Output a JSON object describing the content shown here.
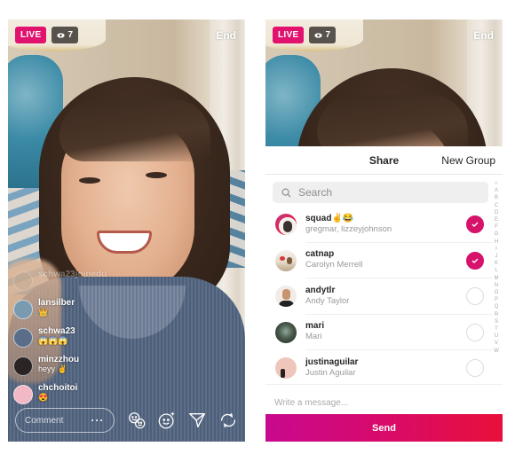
{
  "left_phone": {
    "live_badge": "LIVE",
    "viewer_count": "7",
    "end_label": "End",
    "comments": [
      {
        "user": "schwa23joinedu",
        "message": "",
        "avatar_color": "#b9a68f",
        "faded": true
      },
      {
        "user": "lansilber",
        "message": "👑",
        "avatar_color": "#7a9ab0"
      },
      {
        "user": "schwa23",
        "message": "😱😱😱",
        "avatar_color": "#5a6e8a"
      },
      {
        "user": "minzzhou",
        "message": "heyy ✌",
        "avatar_color": "#2b2424"
      },
      {
        "user": "chchoitoi",
        "message": "😍",
        "avatar_color": "#f2b8c4"
      }
    ],
    "comment_placeholder": "Comment",
    "more_label": "···",
    "icons": [
      "faces-icon",
      "face-effects-icon",
      "send-direct-icon",
      "flip-camera-icon"
    ]
  },
  "right_phone": {
    "live_badge": "LIVE",
    "viewer_count": "7",
    "end_label": "End",
    "share_sheet": {
      "title": "Share",
      "new_group_label": "New Group",
      "search_placeholder": "Search",
      "contacts": [
        {
          "name": "squad✌😂",
          "subtitle": "gregmar, lizzeyjohnson",
          "selected": true,
          "avatar_color": "#3a3230",
          "ring_color": "#c13584"
        },
        {
          "name": "catnap",
          "subtitle": "Carolyn Merrell",
          "selected": true,
          "avatar_color": "#d4c0a8"
        },
        {
          "name": "andytlr",
          "subtitle": "Andy Taylor",
          "selected": false,
          "avatar_color": "#e8d6c6"
        },
        {
          "name": "mari",
          "subtitle": "Mari",
          "selected": false,
          "avatar_color": "#4a5a4c"
        },
        {
          "name": "justinaguilar",
          "subtitle": "Justin Aguilar",
          "selected": false,
          "avatar_color": "#efc6bc"
        }
      ],
      "alpha_index": [
        "☆",
        "A",
        "B",
        "C",
        "D",
        "E",
        "F",
        "G",
        "H",
        "I",
        "J",
        "K",
        "L",
        "M",
        "N",
        "O",
        "P",
        "Q",
        "R",
        "S",
        "T",
        "U",
        "V",
        "W"
      ],
      "message_placeholder": "Write a message...",
      "send_label": "Send"
    }
  },
  "colors": {
    "live": "#e1136f",
    "selected_check": "#d6126a",
    "send_gradient_start": "#c8098f",
    "send_gradient_end": "#e8103a"
  }
}
